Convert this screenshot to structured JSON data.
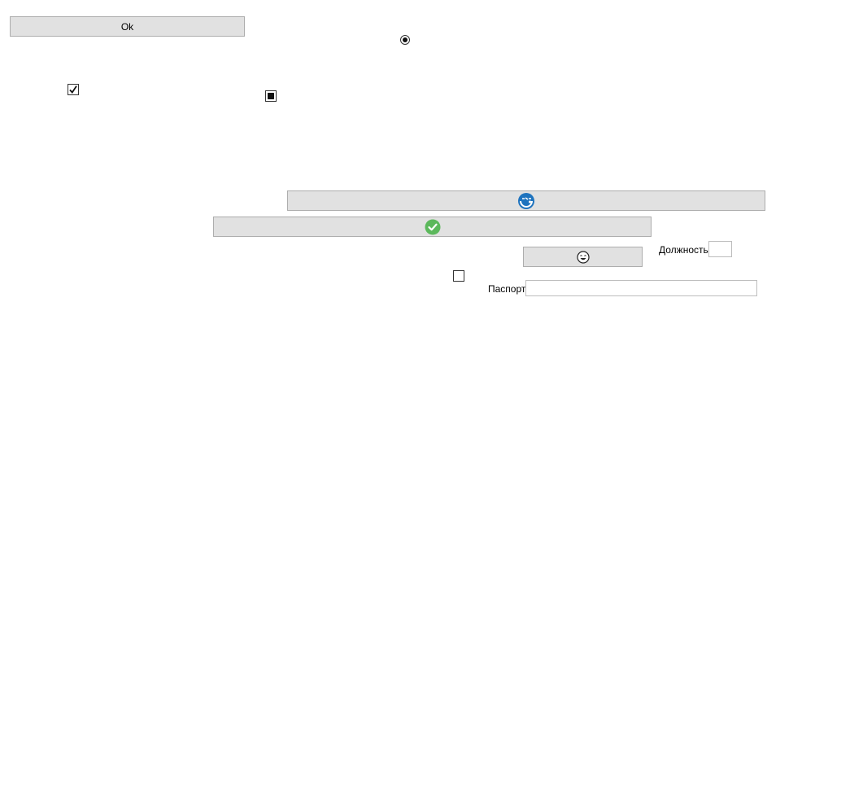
{
  "ok_button": {
    "label": "Ok"
  },
  "radio_button": {
    "checked": true
  },
  "checkbox_checked": {
    "checked": true
  },
  "checkbox_indeterminate": {
    "state": "indeterminate"
  },
  "checkbox_unchecked": {
    "checked": false
  },
  "icon_buttons": {
    "blue_icon_button": {
      "icon": "blue-swirl-icon",
      "color": "#1e73be"
    },
    "green_check_button": {
      "icon": "green-check-icon",
      "color": "#5cb85c"
    },
    "face_icon_button": {
      "icon": "laughing-face-icon"
    }
  },
  "position_field": {
    "label": "Должность",
    "value": ""
  },
  "passport_field": {
    "label": "Паспорт",
    "value": ""
  }
}
